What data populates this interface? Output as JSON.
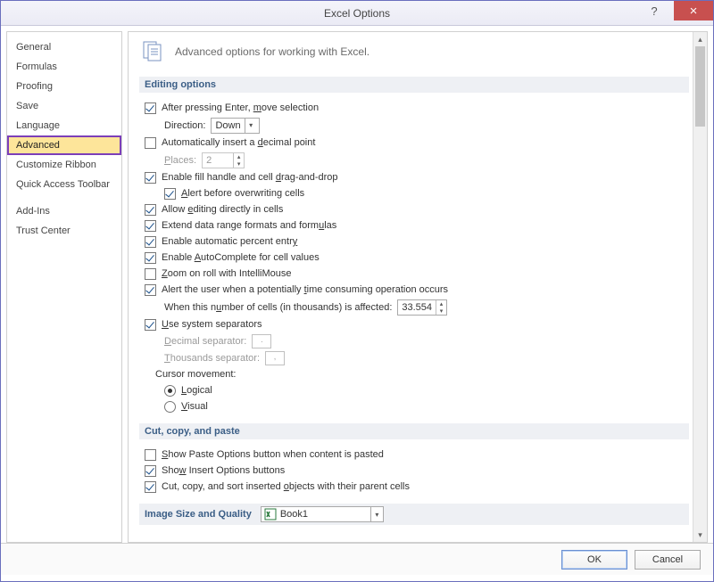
{
  "window": {
    "title": "Excel Options",
    "help": "?",
    "close": "×"
  },
  "sidebar": {
    "items": [
      "General",
      "Formulas",
      "Proofing",
      "Save",
      "Language",
      "Advanced",
      "Customize Ribbon",
      "Quick Access Toolbar",
      "Add-Ins",
      "Trust Center"
    ],
    "selected_index": 5
  },
  "header": "Advanced options for working with Excel.",
  "sections": {
    "editing": {
      "title": "Editing options",
      "after_enter": {
        "checked": true,
        "label": "After pressing Enter, move selection"
      },
      "direction": {
        "label": "Direction:",
        "value": "Down"
      },
      "auto_decimal": {
        "checked": false,
        "label": "Automatically insert a decimal point"
      },
      "places": {
        "label": "Places:",
        "value": "2"
      },
      "fill_handle": {
        "checked": true,
        "label": "Enable fill handle and cell drag-and-drop"
      },
      "alert_overwrite": {
        "checked": true,
        "label": "Alert before overwriting cells"
      },
      "allow_edit": {
        "checked": true,
        "label": "Allow editing directly in cells"
      },
      "extend_range": {
        "checked": true,
        "label": "Extend data range formats and formulas"
      },
      "auto_percent": {
        "checked": true,
        "label": "Enable automatic percent entry"
      },
      "autocomplete": {
        "checked": true,
        "label": "Enable AutoComplete for cell values"
      },
      "zoom_intelli": {
        "checked": false,
        "label": "Zoom on roll with IntelliMouse"
      },
      "alert_time": {
        "checked": true,
        "label": "Alert the user when a potentially time consuming operation occurs"
      },
      "cells_affected": {
        "label": "When this number of cells (in thousands) is affected:",
        "value": "33.554"
      },
      "use_sep": {
        "checked": true,
        "label": "Use system separators"
      },
      "dec_sep": {
        "label": "Decimal separator:",
        "value": "."
      },
      "thou_sep": {
        "label": "Thousands separator:",
        "value": ","
      },
      "cursor_label": "Cursor movement:",
      "cursor_logical": {
        "checked": true,
        "label": "Logical"
      },
      "cursor_visual": {
        "checked": false,
        "label": "Visual"
      }
    },
    "ccp": {
      "title": "Cut, copy, and paste",
      "show_paste": {
        "checked": false,
        "label": "Show Paste Options button when content is pasted"
      },
      "show_insert": {
        "checked": true,
        "label": "Show Insert Options buttons"
      },
      "sort_objects": {
        "checked": true,
        "label": "Cut, copy, and sort inserted objects with their parent cells"
      }
    },
    "image": {
      "title": "Image Size and Quality",
      "workbook": "Book1"
    }
  },
  "footer": {
    "ok": "OK",
    "cancel": "Cancel"
  }
}
